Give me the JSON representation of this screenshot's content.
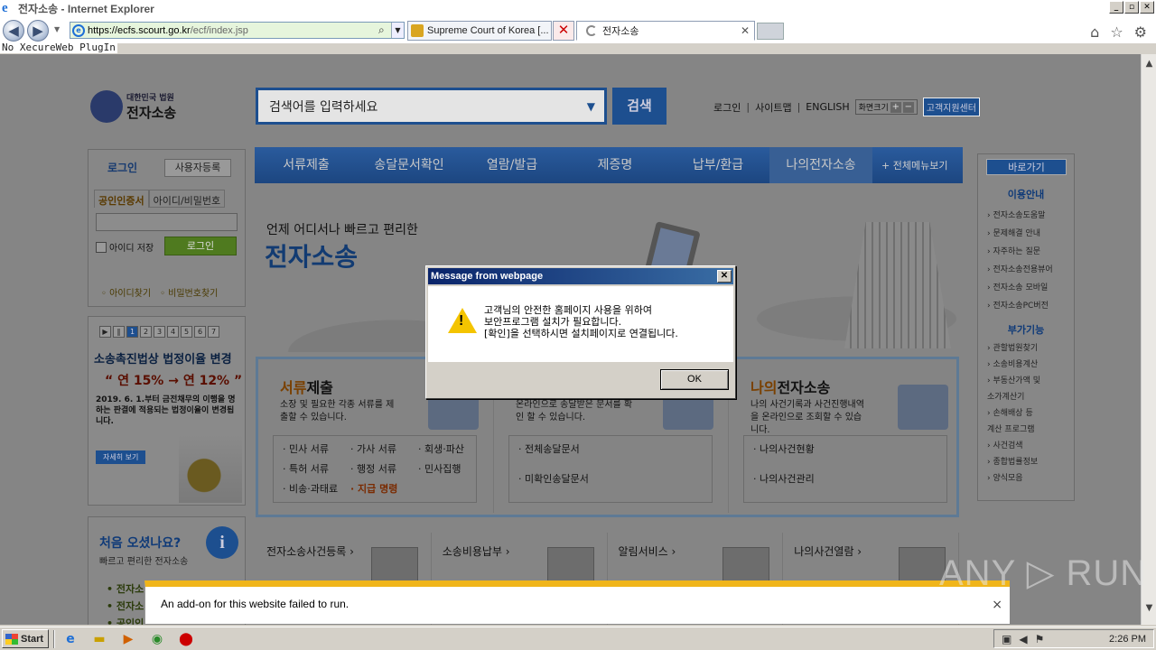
{
  "window": {
    "title": "전자소송 - Internet Explorer",
    "logo_glyph": "e",
    "buttons": [
      "_",
      "▫",
      "✕"
    ]
  },
  "browser": {
    "url_host": "https://ecfs.scourt.go.kr",
    "url_path": "/ecf/index.jsp",
    "tabs": [
      {
        "label": "Supreme Court of Korea [...",
        "close": "✕"
      },
      {
        "label": "전자소송",
        "close": "✕"
      }
    ],
    "toolbar_icons": [
      "home-icon",
      "favorites-icon",
      "tools-icon"
    ],
    "status_line": "No XecureWeb PlugIn"
  },
  "site": {
    "logo_small": "대한민국 법원",
    "logo_big": "전자소송",
    "search_placeholder": "검색어를 입력하세요",
    "search_button": "검색",
    "toplinks": [
      "로그인",
      "사이트맵",
      "ENGLISH"
    ],
    "font_size_label": "화면크기",
    "font_plus": "+",
    "font_minus": "−",
    "help_center": "고객지원센터",
    "nav": [
      "서류제출",
      "송달문서확인",
      "열람/발급",
      "제증명",
      "납부/환급",
      "나의전자소송"
    ],
    "nav_all": "+ 전체메뉴보기",
    "login": {
      "tab": "로그인",
      "register": "사용자등록",
      "subtab_cert": "공인인증서",
      "subtab_id": "아이디/비밀번호",
      "save_id": "아이디 저장",
      "login_button": "로그인",
      "find_id": "◦ 아이디찾기",
      "find_pw": "◦ 비밀번호찾기"
    },
    "promo": {
      "pages": [
        "1",
        "2",
        "3",
        "4",
        "5",
        "6",
        "7"
      ],
      "title": "소송촉진법상 법정이율 변경",
      "rate": "“ 연 15% → 연 12% ”",
      "desc": "2019. 6. 1.부터 금전채무의 이행을 명하는 판결에 적용되는 법정이율이 변경됩니다.",
      "more": "자세히 보기"
    },
    "firstvisit": {
      "title": "처음 오셨나요?",
      "sub": "빠르고 편리한 전자소송",
      "icon_glyph": "i",
      "items": [
        "• 전자소",
        "• 전자소",
        "• 공인인"
      ]
    },
    "quick": {
      "title": "바로가기",
      "sec1": "이용안내",
      "items1": [
        "› 전자소송도움말",
        "› 문제해결 안내",
        "› 자주하는 질문",
        "› 전자소송전용뷰어",
        "› 전자소송 모바일",
        "› 전자소송PC버전"
      ],
      "sec2": "부가기능",
      "items2": [
        "› 관할법원찾기",
        "› 소송비용계산",
        "› 부동산가액 및",
        "  소가계산기",
        "› 손해배상 등",
        "  계산 프로그램",
        "› 사건검색",
        "› 종합법률정보",
        "› 양식모음"
      ]
    },
    "hero": {
      "sub": "언제 어디서나 빠르고 편리한",
      "title": "전자소송"
    },
    "services": [
      {
        "title_a": "서류",
        "title_b": "제출",
        "desc": "소장 및 필요한 각종 서류를 제출할 수 있습니다.",
        "links": [
          "· 민사 서류",
          "· 가사 서류",
          "· 회생·파산",
          "· 특허 서류",
          "· 행정 서류",
          "· 민사집행",
          "· 비송·과태료",
          "· 지급 명령"
        ]
      },
      {
        "title_a": "",
        "title_b": "",
        "desc": "온라인으로 송달받은 문서를 확인 할 수 있습니다.",
        "links": [
          "· 전체송달문서",
          "· 미확인송달문서"
        ]
      },
      {
        "title_a": "나의",
        "title_b": "전자소송",
        "desc": "나의 사건기록과 사건진행내역을 온라인으로 조회할 수 있습니다.",
        "links": [
          "· 나의사건현황",
          "· 나의사건관리"
        ]
      }
    ],
    "bottom_links": [
      "전자소송사건등록 ›",
      "소송비용납부 ›",
      "알림서비스 ›",
      "나의사건열람 ›"
    ]
  },
  "dialog": {
    "title": "Message from webpage",
    "close": "✕",
    "icon_glyph": "!",
    "message": "고객님의 안전한 홈페이지 사용을 위하여\n보안프로그램 설치가 필요합니다.\n[확인]을 선택하시면 설치페이지로 연결됩니다.",
    "ok": "OK"
  },
  "notification": {
    "text": "An add-on for this website failed to run.",
    "close": "×"
  },
  "watermark": "ANY ▷ RUN",
  "taskbar": {
    "start": "Start",
    "quicklaunch": [
      "ie-icon",
      "folder-icon",
      "media-icon",
      "chrome-icon",
      "stop-icon"
    ],
    "time": "2:26 PM"
  }
}
